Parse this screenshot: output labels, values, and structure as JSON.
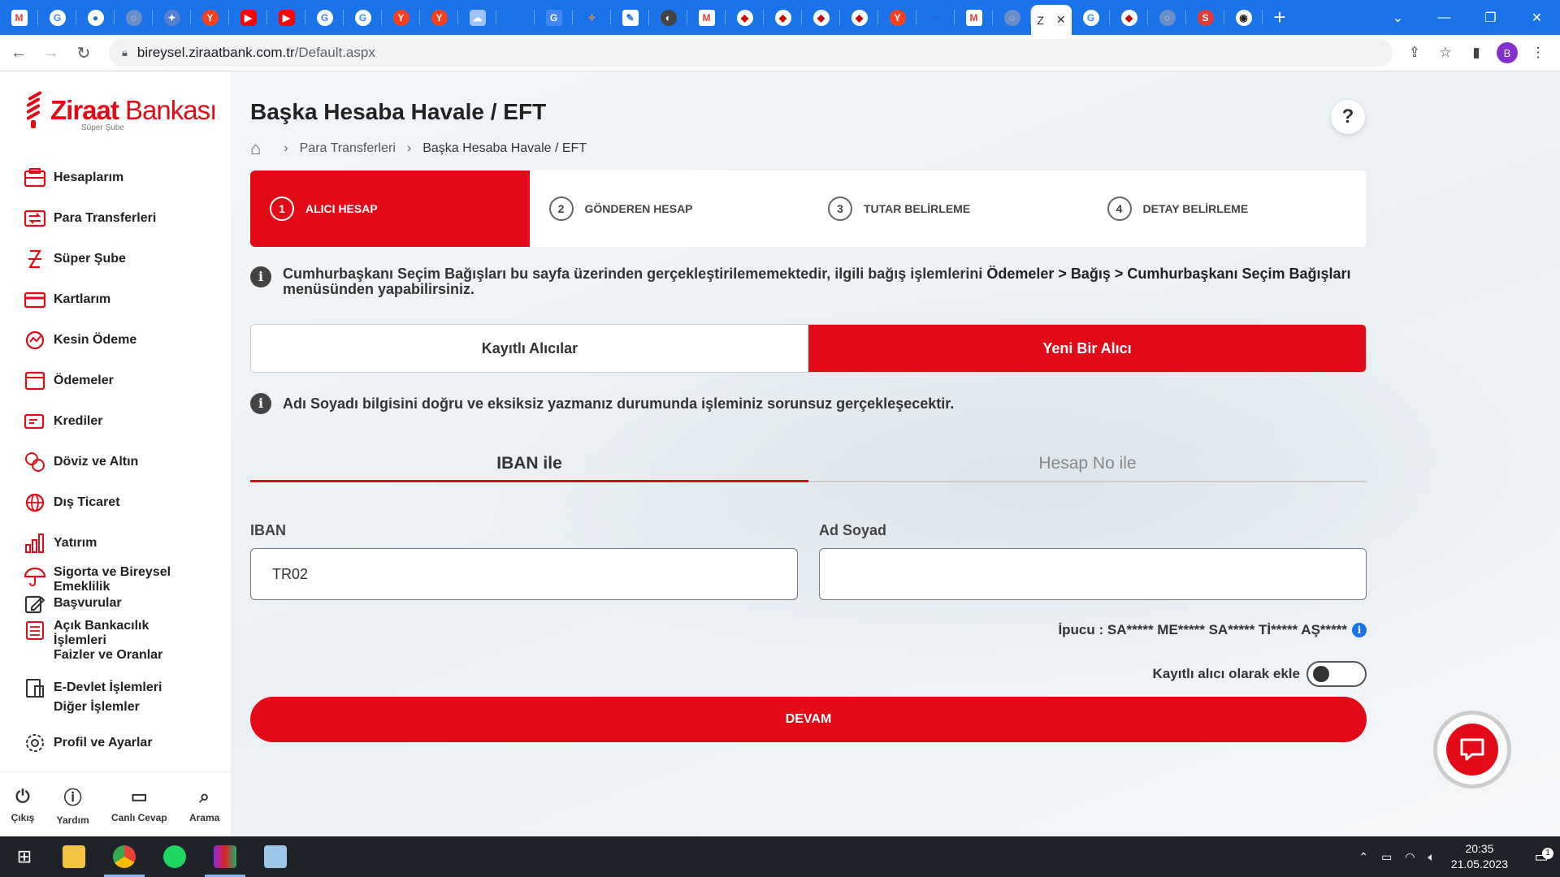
{
  "browser": {
    "url_host": "bireysel.ziraatbank.com.tr",
    "url_path": "/Default.aspx",
    "active_tab_label": "Z",
    "profile_initial": "B"
  },
  "brand": {
    "name_bold": "Ziraat",
    "name_light": " Bankası",
    "sub": "Süper Şube",
    "accent": "#e30a17"
  },
  "sidebar": {
    "items": [
      {
        "label": "Hesaplarım",
        "icon": "wallet-icon"
      },
      {
        "label": "Para Transferleri",
        "icon": "transfer-icon"
      },
      {
        "label": "Süper Şube",
        "icon": "super-branch-icon"
      },
      {
        "label": "Kartlarım",
        "icon": "card-icon"
      },
      {
        "label": "Kesin Ödeme",
        "icon": "payment-icon"
      },
      {
        "label": "Ödemeler",
        "icon": "bill-icon"
      },
      {
        "label": "Krediler",
        "icon": "loan-icon"
      },
      {
        "label": "Döviz ve Altın",
        "icon": "currency-icon"
      },
      {
        "label": "Dış Ticaret",
        "icon": "trade-icon"
      },
      {
        "label": "Yatırım",
        "icon": "investment-icon"
      },
      {
        "label": "Sigorta ve Bireysel Emeklilik",
        "icon": "umbrella-icon"
      },
      {
        "label": "Başvurular",
        "icon": "application-icon"
      },
      {
        "label": "Açık Bankacılık İşlemleri",
        "icon": "open-banking-icon"
      },
      {
        "label": "Faizler ve Oranlar",
        "icon": "rates-icon"
      },
      {
        "label": "E-Devlet İşlemleri",
        "icon": "gov-icon"
      },
      {
        "label": "Diğer İşlemler",
        "icon": "other-icon"
      },
      {
        "label": "Profil ve Ayarlar",
        "icon": "gear-icon"
      }
    ],
    "footer": [
      {
        "label": "Çıkış",
        "icon": "power-icon"
      },
      {
        "label": "Yardım",
        "icon": "help-icon"
      },
      {
        "label": "Canlı Cevap",
        "icon": "chat-icon"
      },
      {
        "label": "Arama",
        "icon": "search-icon"
      }
    ]
  },
  "main": {
    "title": "Başka Hesaba Havale / EFT",
    "help": "?",
    "breadcrumb": [
      "Para Transferleri",
      "Başka Hesaba Havale / EFT"
    ],
    "steps": [
      {
        "num": "1",
        "label": "ALICI HESAP"
      },
      {
        "num": "2",
        "label": "GÖNDEREN HESAP"
      },
      {
        "num": "3",
        "label": "TUTAR BELİRLEME"
      },
      {
        "num": "4",
        "label": "DETAY BELİRLEME"
      }
    ],
    "info1_prefix": "Cumhurbaşkanı Seçim Bağışları bu sayfa üzerinden gerçekleştirilememektedir, ilgili bağış işlemlerini ",
    "info1_bold": "Ödemeler > Bağış > Cumhurbaşkanı Seçim Bağışları",
    "info1_suffix": " menüsünden yapabilirsiniz.",
    "segment": {
      "saved": "Kayıtlı Alıcılar",
      "new": "Yeni Bir Alıcı"
    },
    "info2": "Adı Soyadı bilgisini doğru ve eksiksiz yazmanız durumunda işleminiz sorunsuz gerçekleşecektir.",
    "subtabs": {
      "iban": "IBAN ile",
      "account": "Hesap No ile"
    },
    "iban_label": "IBAN",
    "iban_value": "TR02",
    "name_label": "Ad Soyad",
    "name_value": "",
    "hint": "İpucu : SA***** ME***** SA***** Tİ***** AŞ*****",
    "save_label": "Kayıtlı alıcı olarak ekle",
    "submit": "DEVAM"
  },
  "taskbar": {
    "time": "20:35",
    "date": "21.05.2023",
    "notifications": "1"
  }
}
